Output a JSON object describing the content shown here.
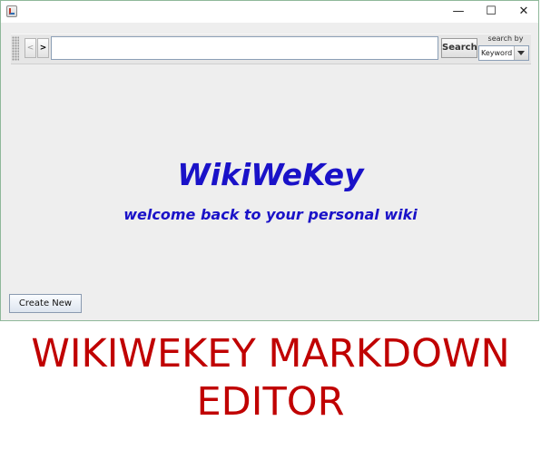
{
  "window": {
    "controls": {
      "minimize": "—",
      "maximize": "☐",
      "close": "✕"
    }
  },
  "toolbar": {
    "back_label": "<",
    "forward_label": ">",
    "search_value": "",
    "search_button": "Search",
    "search_by_label": "search by",
    "search_by_selected": "Keyword"
  },
  "main": {
    "title": "WikiWeKey",
    "subtitle": "welcome back to your personal wiki",
    "title_color": "#1a12c8"
  },
  "footer": {
    "create_new": "Create New"
  },
  "caption": {
    "line1": "WIKIWEKEY MARKDOWN",
    "line2": "EDITOR",
    "color": "#c00000"
  },
  "icons": [
    "java-app-icon",
    "minimize-icon",
    "maximize-icon",
    "close-icon",
    "toolbar-grip-icon",
    "chevron-down-icon"
  ]
}
